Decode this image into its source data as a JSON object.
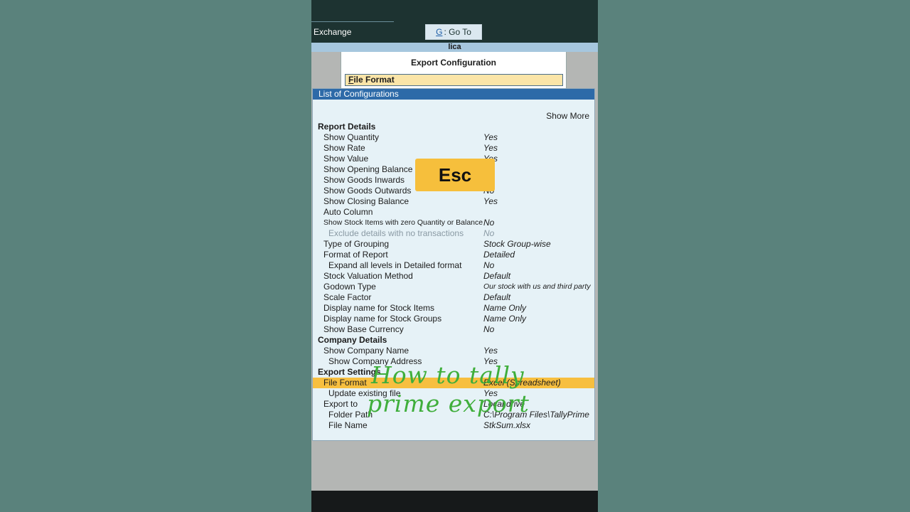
{
  "header": {
    "exchange_label": "Exchange",
    "goto_key": "G",
    "goto_label": ": Go To"
  },
  "title_strip": "lica",
  "export_config": {
    "heading": "Export Configuration",
    "field_key": "F",
    "field_rest": "ile Format"
  },
  "list": {
    "heading": "List of Configurations",
    "show_more": "Show More",
    "rows": [
      {
        "label": "Report Details",
        "value": "",
        "kind": "sec"
      },
      {
        "label": "Show Quantity",
        "value": "Yes"
      },
      {
        "label": "Show Rate",
        "value": "Yes"
      },
      {
        "label": "Show Value",
        "value": "Yes"
      },
      {
        "label": "Show Opening Balance",
        "value": ""
      },
      {
        "label": "Show Goods Inwards",
        "value": ""
      },
      {
        "label": "Show Goods Outwards",
        "value": "No"
      },
      {
        "label": "Show Closing Balance",
        "value": "Yes"
      },
      {
        "label": "Auto Column",
        "value": ""
      },
      {
        "label": "Show Stock Items with zero Quantity or Balance",
        "value": "No",
        "kind": "small"
      },
      {
        "label": "Exclude details with no transactions",
        "value": "No",
        "kind": "ind dim"
      },
      {
        "label": "Type of Grouping",
        "value": "Stock Group-wise"
      },
      {
        "label": "Format of Report",
        "value": "Detailed"
      },
      {
        "label": "Expand all levels in Detailed format",
        "value": "No",
        "kind": "ind"
      },
      {
        "label": "Stock Valuation Method",
        "value": "Default"
      },
      {
        "label": "Godown Type",
        "value": "Our stock with us and third party",
        "val_small": true
      },
      {
        "label": "Scale Factor",
        "value": "Default"
      },
      {
        "label": "Display name for Stock Items",
        "value": "Name Only"
      },
      {
        "label": "Display name for Stock Groups",
        "value": "Name Only"
      },
      {
        "label": "Show Base Currency",
        "value": "No"
      },
      {
        "label": "Company Details",
        "value": "",
        "kind": "sec"
      },
      {
        "label": "Show Company Name",
        "value": "Yes"
      },
      {
        "label": "Show Company Address",
        "value": "Yes",
        "kind": "ind"
      },
      {
        "label": "Export Settings",
        "value": "",
        "kind": "sec"
      },
      {
        "label": "File Format",
        "value": "Excel (Spreadsheet)",
        "kind": "hl"
      },
      {
        "label": "Update existing file",
        "value": "Yes",
        "kind": "ind"
      },
      {
        "label": "Export to",
        "value": "Local drive"
      },
      {
        "label": "Folder Path",
        "value": "C:\\Program Files\\TallyPrime",
        "kind": "ind"
      },
      {
        "label": "File Name",
        "value": "StkSum.xlsx",
        "kind": "ind"
      }
    ]
  },
  "esc_label": "Esc",
  "overlay": {
    "line1": "How to tally",
    "line2": "prime export"
  }
}
